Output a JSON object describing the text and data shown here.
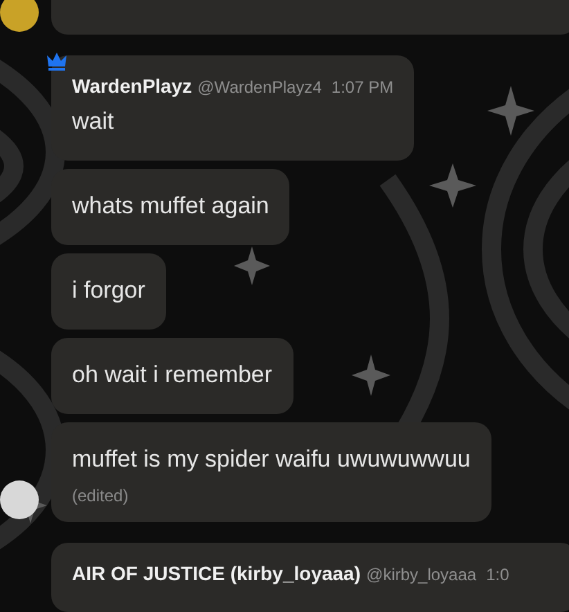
{
  "groups": [
    {
      "kind": "cut-off",
      "avatar": {
        "color": "#c9a227"
      }
    },
    {
      "kind": "message-group",
      "crown": true,
      "avatar": {
        "color": "#d8d8d8"
      },
      "author": {
        "name": "WardenPlayz",
        "handle": "@WardenPlayz4",
        "time": "1:07 PM"
      },
      "messages": [
        {
          "text": "wait",
          "edited": false
        },
        {
          "text": "whats muffet again",
          "edited": false
        },
        {
          "text": "i forgor",
          "edited": false
        },
        {
          "text": "oh wait i remember",
          "edited": false
        },
        {
          "text": "muffet is my spider waifu uwuwuwwuu",
          "edited": true,
          "edited_label": "(edited)"
        }
      ]
    },
    {
      "kind": "message-group",
      "crown": false,
      "author": {
        "name": "AIR OF JUSTICE (kirby_loyaaa)",
        "handle": "@kirby_loyaaa",
        "time": "1:0"
      }
    }
  ]
}
